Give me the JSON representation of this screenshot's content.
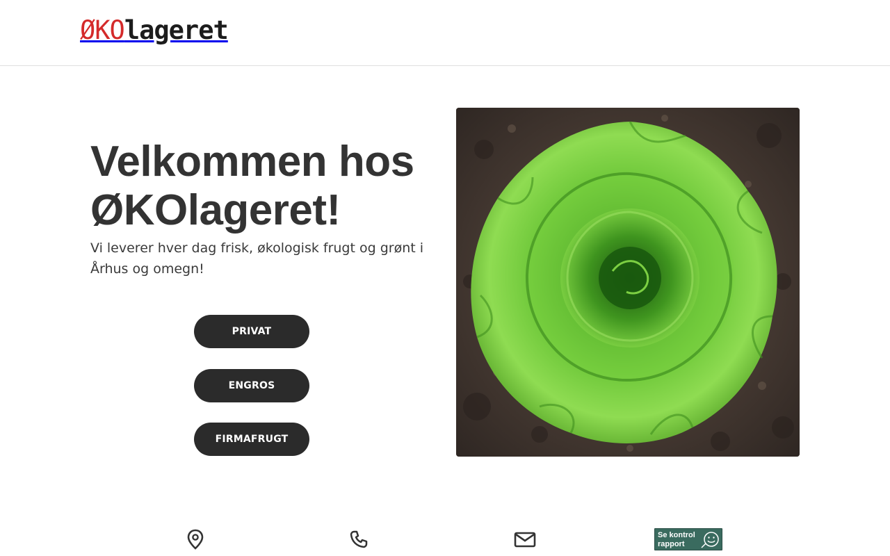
{
  "header": {
    "logo_prefix": "ØKO",
    "logo_suffix": "lageret"
  },
  "hero": {
    "title": "Velkommen hos ØKOlageret!",
    "subtitle": "Vi leverer hver dag frisk, økologisk frugt og grønt i Århus og omegn!",
    "buttons": [
      "PRIVAT",
      "ENGROS",
      "FIRMAFRUGT"
    ],
    "image": "lettuce-head-in-soil"
  },
  "contact": {
    "icons": [
      "location-pin-icon",
      "phone-icon",
      "mail-icon"
    ],
    "badge_line1": "Se kontrol",
    "badge_line2": "rapport",
    "badge_icon": "smiley-icon"
  },
  "colors": {
    "logo_red": "#d42a2a",
    "button_bg": "#2b2b2b",
    "text": "#333333",
    "badge_green": "#3a6b5f"
  }
}
